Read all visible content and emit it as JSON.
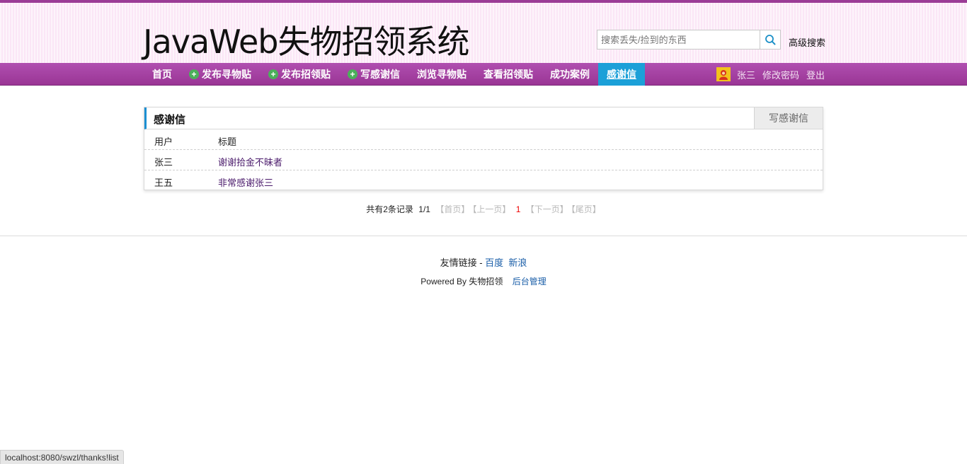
{
  "header": {
    "logo": "JavaWeb失物招领系统",
    "search_placeholder": "搜索丢失/捡到的东西",
    "advanced_search": "高级搜索"
  },
  "nav": {
    "items": [
      {
        "label": "首页",
        "icon": ""
      },
      {
        "label": "发布寻物贴",
        "icon": "plus-circle-icon"
      },
      {
        "label": "发布招领贴",
        "icon": "plus-circle-icon"
      },
      {
        "label": "写感谢信",
        "icon": "plus-circle-icon"
      },
      {
        "label": "浏览寻物贴",
        "icon": ""
      },
      {
        "label": "查看招领贴",
        "icon": ""
      },
      {
        "label": "成功案例",
        "icon": ""
      },
      {
        "label": "感谢信",
        "icon": "",
        "active": true
      }
    ],
    "user": {
      "name": "张三",
      "change_password": "修改密码",
      "logout": "登出"
    }
  },
  "panel": {
    "title": "感谢信",
    "write_button": "写感谢信",
    "columns": {
      "user": "用户",
      "title": "标题"
    },
    "rows": [
      {
        "user": "张三",
        "title": "谢谢拾金不昧者"
      },
      {
        "user": "王五",
        "title": "非常感谢张三"
      }
    ]
  },
  "pager": {
    "total": "共有2条记录",
    "position": "1/1",
    "first": "【首页】",
    "prev": "【上一页】",
    "current": "1",
    "next": "【下一页】",
    "last": "【尾页】"
  },
  "footer": {
    "links_label": "友情链接 -",
    "link_baidu": "百度",
    "link_sina": "新浪",
    "powered": "Powered By 失物招领",
    "admin": "后台管理"
  },
  "status_url": "localhost:8080/swzl/thanks!list",
  "colors": {
    "nav": "#9b3c96",
    "active_tab": "#1ba0d8",
    "header_bg": "#fbe6f6"
  }
}
